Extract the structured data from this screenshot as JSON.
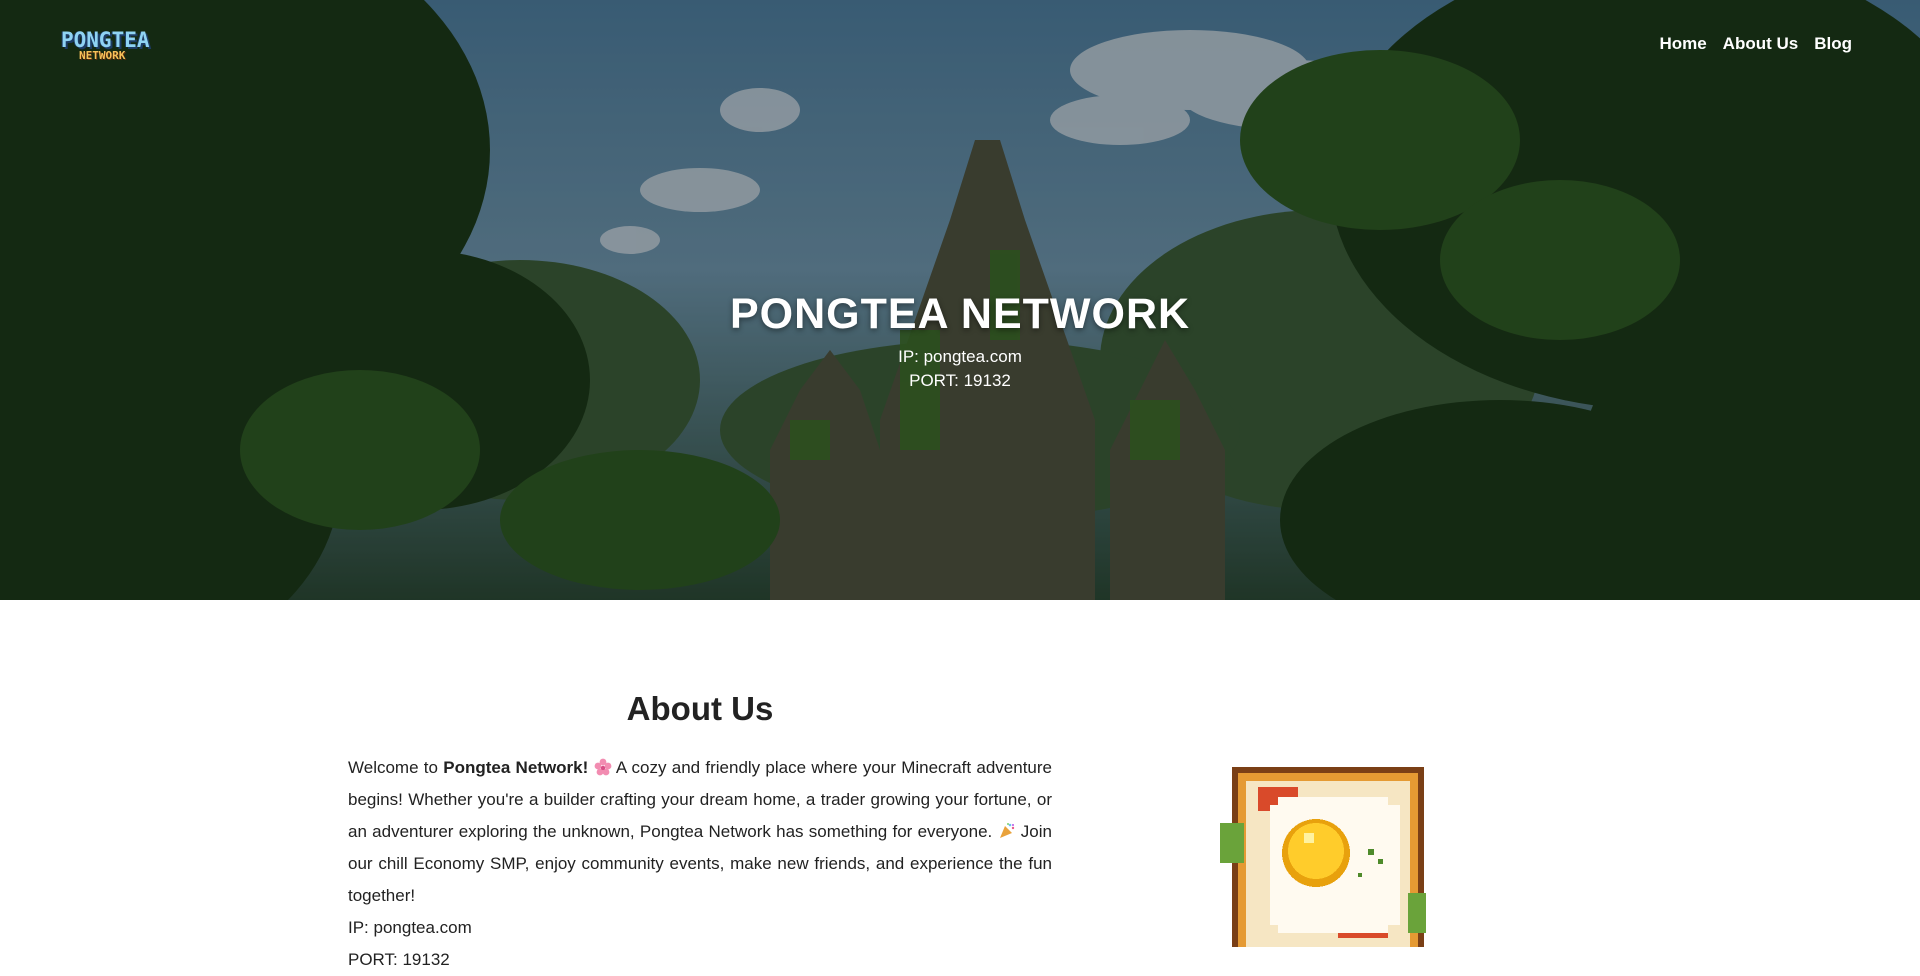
{
  "header": {
    "logo_top": "PONGTEA",
    "logo_bottom": "NETWORK",
    "nav": [
      "Home",
      "About Us",
      "Blog"
    ]
  },
  "hero": {
    "title": "PONGTEA NETWORK",
    "ip_line": "IP: pongtea.com",
    "port_line": "PORT: 19132"
  },
  "about": {
    "heading": "About Us",
    "intro_welcome": "Welcome to ",
    "intro_brand": "Pongtea Network!",
    "intro_part1": " A cozy and friendly place where your Minecraft adventure begins! Whether you're a builder crafting your dream home, a trader growing your fortune, or an adventurer exploring the unknown, Pongtea Network has something for everyone. ",
    "intro_part2": " Join our chill Economy SMP, enjoy community events, make new friends, and experience the fun together!",
    "ip_line": "IP: pongtea.com",
    "port_line": "PORT: 19132",
    "flower_icon": "cherry-blossom-icon",
    "party_icon": "party-popper-icon"
  }
}
